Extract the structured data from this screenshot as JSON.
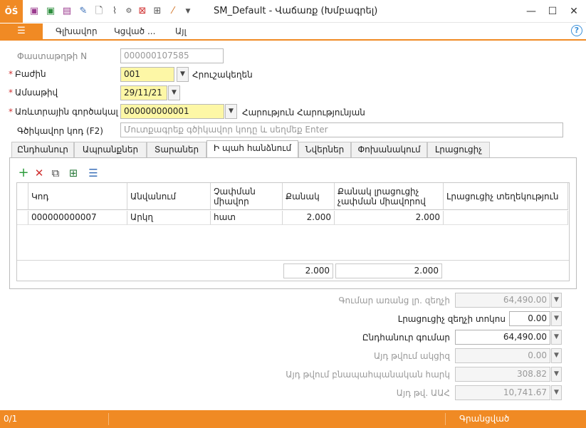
{
  "window": {
    "app_logo": "ŌŚ",
    "title": "SM_Default - Վաճառք (Խմբագրել)",
    "toolbar_icons": [
      "save-icon",
      "save-close-icon",
      "save-copy-icon",
      "edit-icon",
      "document-icon",
      "attach-icon",
      "options-icon",
      "delete-grid-icon",
      "grid-icon",
      "magic-wand-icon",
      "more-icon"
    ],
    "minimize": "—",
    "maximize": "☐",
    "close": "✕"
  },
  "menu": {
    "items": [
      "Գլխավոր",
      "Կցված ...",
      "Այլ"
    ],
    "help": "?"
  },
  "form": {
    "doc_number": {
      "label": "Փաստաթղթի N",
      "value": "000000107585"
    },
    "department": {
      "label": "Բաժին",
      "value": "001",
      "desc": "Հրուշակեղեն"
    },
    "date": {
      "label": "Ամսաթիվ",
      "value": "29/11/21"
    },
    "partner": {
      "label": "Առևտրային գործակալ",
      "value": "000000000001",
      "desc": "Հարություն Հարությունյան"
    },
    "barcode": {
      "label": "Գծիկավոր կոդ (F2)",
      "placeholder": "Մուտքագրեք գծիկավոր կոդը և սեղմեք Enter"
    }
  },
  "tabs": [
    "Ընդհանուր",
    "Ապրանքներ",
    "Տարաներ",
    "Ի պահ հանձնում",
    "Նվերներ",
    "Փոխանակում",
    "Լրացուցիչ"
  ],
  "active_tab": "Ի պահ հանձնում",
  "grid": {
    "columns": [
      "Կոդ",
      "Անվանում",
      "Չափման միավոր",
      "Քանակ",
      "Քանակ լրացուցիչ չափման միավորով",
      "Լրացուցիչ տեղեկություն"
    ],
    "rows": [
      {
        "code": "000000000007",
        "name": "Արկղ",
        "unit": "հատ",
        "qty": "2.000",
        "qty_extra": "2.000",
        "info": ""
      }
    ],
    "totals": {
      "qty": "2.000",
      "qty_extra": "2.000"
    }
  },
  "summary": {
    "sum_no_discount": {
      "label": "Գումար առանց լր. զեղչի",
      "value": "64,490.00"
    },
    "extra_discount_pct": {
      "label": "Լրացուցիչ զեղչի տոկոս",
      "value": "0.00"
    },
    "total": {
      "label": "Ընդհանուր գումար",
      "value": "64,490.00"
    },
    "excise": {
      "label": "Այդ թվում ակցիզ",
      "value": "0.00"
    },
    "env_tax": {
      "label": "Այդ թվում բնապահպանական հարկ",
      "value": "308.82"
    },
    "vat": {
      "label": "Այդ թվ. ԱԱՀ",
      "value": "10,741.67"
    }
  },
  "status": {
    "counter": "0/1",
    "state": "Գրանցված"
  },
  "colors": {
    "accent": "#f08a24",
    "required_field": "#fdf7a6"
  }
}
